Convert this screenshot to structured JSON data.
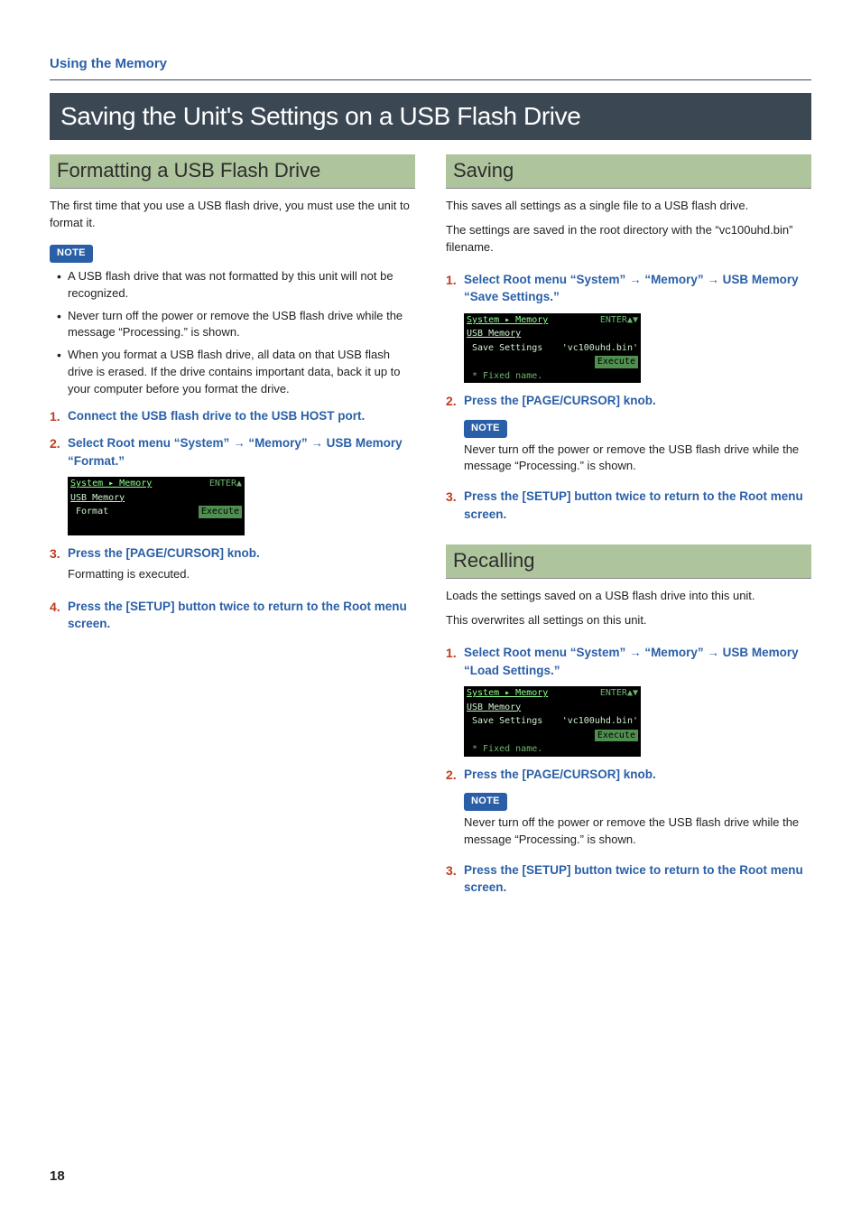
{
  "header": {
    "section": "Using the Memory"
  },
  "main_title": "Saving the Unit's Settings on a USB Flash Drive",
  "left": {
    "title": "Formatting a USB Flash Drive",
    "intro": "The first time that you use a USB flash drive, you must use the unit to format it.",
    "note_label": "NOTE",
    "notes": [
      "A USB flash drive that was not formatted by this unit will not be recognized.",
      "Never turn off the power or remove the USB flash drive while the message “Processing.” is shown.",
      "When you format a USB flash drive, all data on that USB flash drive is erased. If the drive contains important data, back it up to your computer before you format the drive."
    ],
    "steps": [
      {
        "num": "1.",
        "title": "Connect the USB flash drive to the USB HOST port."
      },
      {
        "num": "2.",
        "title_a": "Select Root menu “System” ",
        "arrow": "→",
        "title_b": " “Memory” ",
        "title_c": " USB Memory “Format.”"
      },
      {
        "num": "3.",
        "title": "Press the [PAGE/CURSOR] knob.",
        "sub": "Formatting is executed."
      },
      {
        "num": "4.",
        "title": "Press the [SETUP] button twice to return to the Root menu screen."
      }
    ],
    "screenshot": {
      "breadcrumb_l": "System ▸ Memory",
      "breadcrumb_r": "ENTER▲",
      "l1": "USB Memory",
      "l2": "Format",
      "exec": "Execute"
    }
  },
  "right": {
    "saving": {
      "title": "Saving",
      "intro1": "This saves all settings as a single file to a USB flash drive.",
      "intro2": "The settings are saved in the root directory with the “vc100uhd.bin” filename.",
      "steps": [
        {
          "num": "1.",
          "title_a": "Select Root menu “System” ",
          "arrow": "→",
          "title_b": " “Memory” ",
          "title_c": " USB Memory “Save Settings.”"
        },
        {
          "num": "2.",
          "title": "Press the [PAGE/CURSOR] knob."
        },
        {
          "num": "3.",
          "title": "Press the [SETUP] button twice to return to the Root menu screen."
        }
      ],
      "note_label": "NOTE",
      "note_text": "Never turn off the power or remove the USB flash drive while the message “Processing.” is shown.",
      "screenshot": {
        "breadcrumb_l": "System ▸ Memory",
        "breadcrumb_r": "ENTER▲▼",
        "l1": "USB Memory",
        "l2": "Save Settings",
        "fname": "'vc100uhd.bin'",
        "exec": "Execute",
        "fixed": "* Fixed name."
      }
    },
    "recalling": {
      "title": "Recalling",
      "intro1": "Loads the settings saved on a USB flash drive into this unit.",
      "intro2": "This overwrites all settings on this unit.",
      "steps": [
        {
          "num": "1.",
          "title_a": "Select Root menu “System” ",
          "arrow": "→",
          "title_b": " “Memory” ",
          "title_c": " USB Memory “Load Settings.”"
        },
        {
          "num": "2.",
          "title": "Press the [PAGE/CURSOR] knob."
        },
        {
          "num": "3.",
          "title": "Press the [SETUP] button twice to return to the Root menu screen."
        }
      ],
      "note_label": "NOTE",
      "note_text": "Never turn off the power or remove the USB flash drive while the message “Processing.” is shown.",
      "screenshot": {
        "breadcrumb_l": "System ▸ Memory",
        "breadcrumb_r": "ENTER▲▼",
        "l1": "USB Memory",
        "l2": "Save Settings",
        "fname": "'vc100uhd.bin'",
        "exec": "Execute",
        "fixed": "* Fixed name."
      }
    }
  },
  "page_number": "18"
}
